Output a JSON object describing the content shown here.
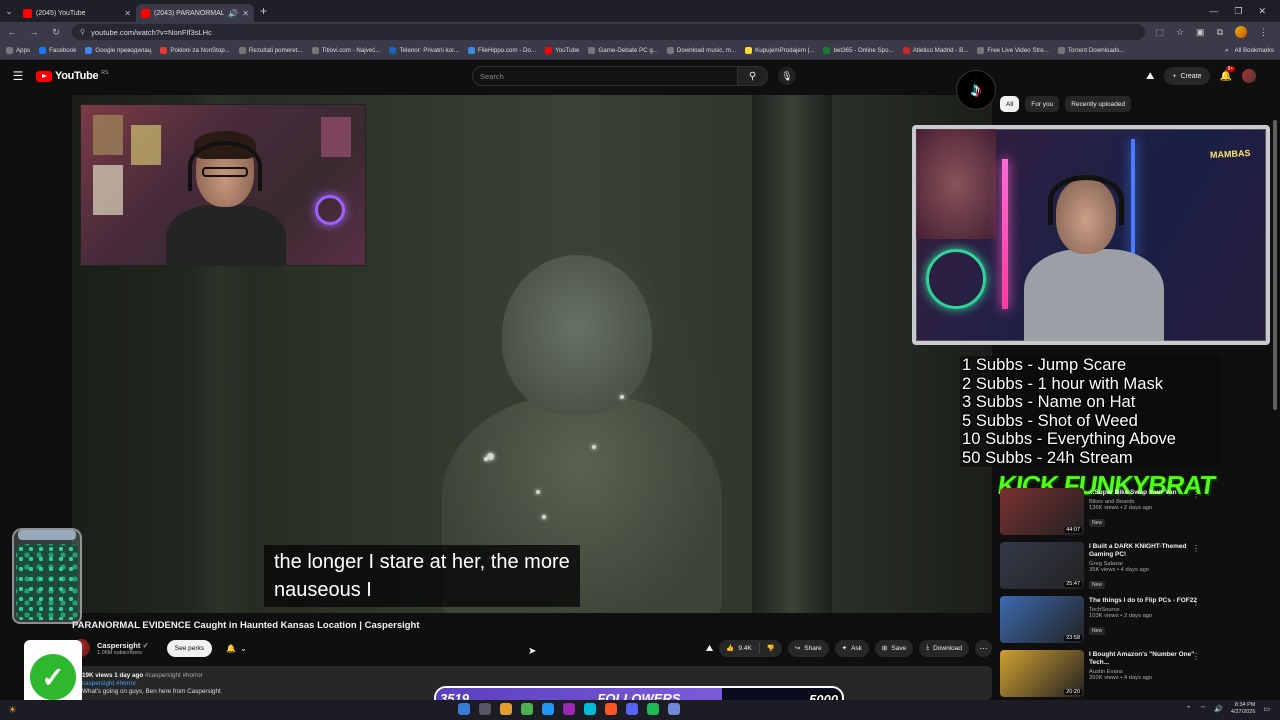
{
  "browser": {
    "tabs": [
      {
        "title": "(2045) YouTube",
        "active": false
      },
      {
        "title": "(2043) PARANORMAL EVIDE",
        "active": true
      }
    ],
    "url": "youtube.com/watch?v=NonFIf3sLHc",
    "bookmarks": [
      "Apps",
      "Facebook",
      "Google преводилац",
      "Pokloni za NonStop...",
      "Rezultati pomeret...",
      "Titlovi.com - Najveć...",
      "Telenor: Privatni kor...",
      "FileHippo.com - Do...",
      "YouTube",
      "Game-Debate PC g...",
      "Download music, m...",
      "KupujemProdajem |...",
      "bet365 - Online Spo...",
      "Atletico Madrid - B...",
      "Free Live Video Stre...",
      "Torrent Downloads..."
    ],
    "all_bookmarks": "All Bookmarks"
  },
  "youtube": {
    "logo": "YouTube",
    "logo_region": "RS",
    "search_placeholder": "Search",
    "create": "Create",
    "notif_count": "9+",
    "chips": [
      "All",
      "For you",
      "Recently uploaded"
    ]
  },
  "video": {
    "subtitle_line1": "the longer I stare at her, the more",
    "subtitle_line2": "nauseous I",
    "title": "PARANORMAL EVIDENCE Caught in Haunted Kansas Location | Caspersight",
    "channel": "Caspersight",
    "subscribers": "1.06M subscribers",
    "perks": "See perks",
    "likes": "9.4K",
    "share": "Share",
    "ask": "Ask",
    "save": "Save",
    "download": "Download",
    "views": "19K views  1 day ago",
    "tags": "#caspersight #horror",
    "hashtag": "caspersight #horror",
    "desc_line": "What's going on guys, Ben here from Caspersight"
  },
  "overlay": {
    "goals": [
      "1 Subbs - Jump Scare",
      "2 Subbs - 1 hour with Mask",
      "3 Subbs - Name on Hat",
      "5 Subbs - Shot of Weed",
      "10 Subbs - Everything Above",
      "50 Subbs - 24h Stream"
    ],
    "kick_text": "KICK FUNKYBRAT",
    "followers_current": "3519",
    "followers_label": "FOLLOWERS",
    "followers_goal": "5000",
    "followers_progress": 0.7038,
    "webcam2_text": "MAMBAS"
  },
  "recommendations": [
    {
      "title": "...Super Bike Swap Your Van",
      "channel": "Bikes and Beards",
      "views": "136K views • 2 days ago",
      "badge": "New",
      "duration": "44:07",
      "color": "#7a3030"
    },
    {
      "title": "I Built a DARK KNIGHT-Themed Gaming PC!",
      "channel": "Greg Salazar",
      "views": "35K views • 4 days ago",
      "badge": "New",
      "duration": "25:47",
      "color": "#333a48"
    },
    {
      "title": "The things I do to Flip PCs - FOF22",
      "channel": "TechSource",
      "views": "103K views • 2 days ago",
      "badge": "New",
      "duration": "23:58",
      "color": "#3b6ab0"
    },
    {
      "title": "I Bought Amazon's \"Number One\" Tech...",
      "channel": "Austin Evans",
      "views": "392K views • 4 days ago",
      "badge": "",
      "duration": "20:20",
      "color": "#d0a030"
    }
  ],
  "taskbar": {
    "time": "8:34 PM",
    "date": "4/27/2026"
  }
}
